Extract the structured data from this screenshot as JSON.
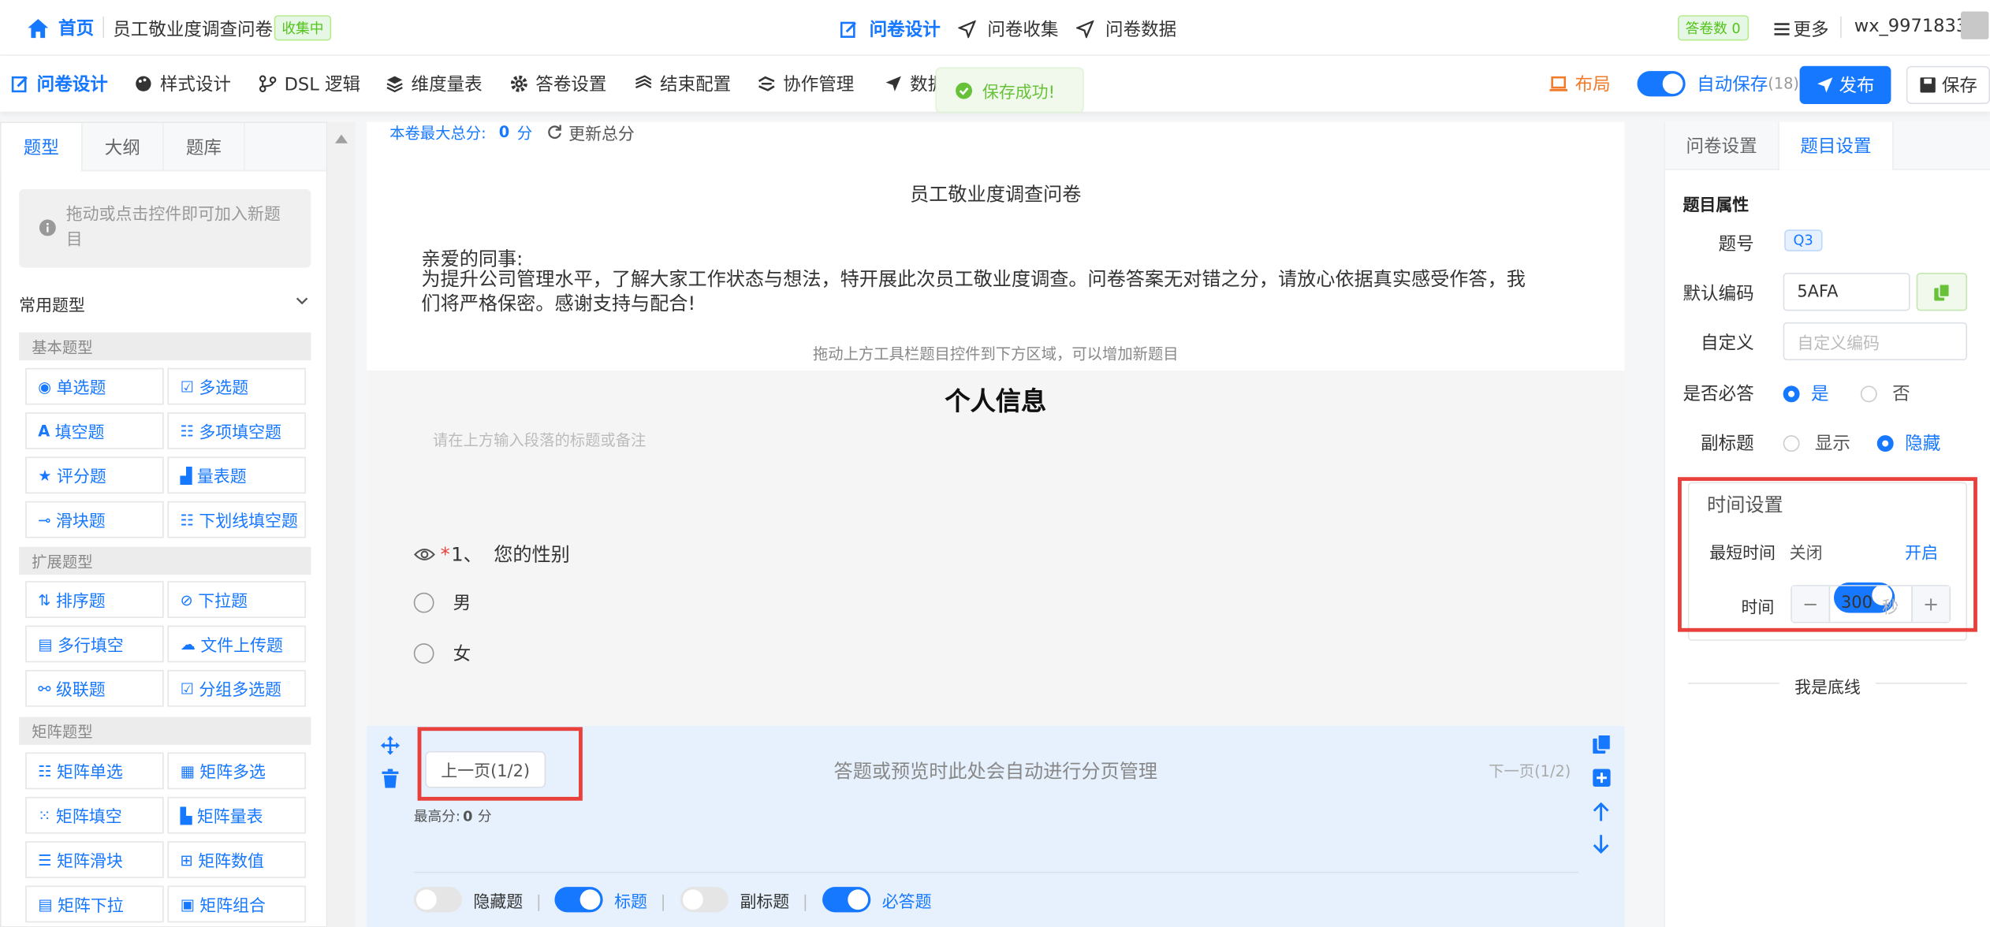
{
  "topbar": {
    "home": "首页",
    "survey_title": "员工敬业度调查问卷",
    "status_badge": "收集中",
    "nav": [
      "问卷设计",
      "问卷收集",
      "问卷数据"
    ],
    "answer_count": "答卷数 0",
    "more": "更多",
    "user": "wx_9971833"
  },
  "toolbar": {
    "items": [
      "问卷设计",
      "样式设计",
      "DSL 逻辑",
      "维度量表",
      "答卷设置",
      "结束配置",
      "协作管理",
      "数据"
    ],
    "layout": "布局",
    "autosave": "自动保存",
    "autosave_count": "(18)",
    "publish": "发布",
    "save": "保存"
  },
  "toast": "保存成功!",
  "left": {
    "tabs": [
      "题型",
      "大纲",
      "题库"
    ],
    "hint": "拖动或点击控件即可加入新题目",
    "section": "常用题型",
    "groups": [
      {
        "title": "基本题型",
        "items": [
          "单选题",
          "多选题",
          "填空题",
          "多项填空题",
          "评分题",
          "量表题",
          "滑块题",
          "下划线填空题"
        ]
      },
      {
        "title": "扩展题型",
        "items": [
          "排序题",
          "下拉题",
          "多行填空",
          "文件上传题",
          "级联题",
          "分组多选题"
        ]
      },
      {
        "title": "矩阵题型",
        "items": [
          "矩阵单选",
          "矩阵多选",
          "矩阵填空",
          "矩阵量表",
          "矩阵滑块",
          "矩阵数值",
          "矩阵下拉",
          "矩阵组合"
        ]
      }
    ]
  },
  "center": {
    "max_score_label": "本卷最大总分:",
    "max_score_value": "0",
    "score_unit": "分",
    "update_total": "更新总分",
    "title": "员工敬业度调查问卷",
    "intro_line1": "亲爱的同事:",
    "intro_line2": "为提升公司管理水平，了解大家工作状态与想法，特开展此次员工敬业度调查。问卷答案无对错之分，请放心依据真实感受作答，我们将严格保密。感谢支持与配合!",
    "drag_hint": "拖动上方工具栏题目控件到下方区域，可以增加新题目",
    "section_title": "个人信息",
    "section_placeholder": "请在上方输入段落的标题或备注",
    "q_required": "*",
    "q_num": "1、",
    "q_text": "您的性别",
    "options": [
      "男",
      "女"
    ],
    "pager_prev": "上一页(1/2)",
    "pager_hint": "答题或预览时此处会自动进行分页管理",
    "pager_next": "下一页(1/2)",
    "max_label": "最高分:",
    "max_value": "0",
    "toggles": [
      {
        "label": "隐藏题",
        "on": false
      },
      {
        "label": "标题",
        "on": true
      },
      {
        "label": "副标题",
        "on": false
      },
      {
        "label": "必答题",
        "on": true
      }
    ]
  },
  "right": {
    "tabs": [
      "问卷设置",
      "题目设置"
    ],
    "section": "题目属性",
    "qno_label": "题号",
    "qno_value": "Q3",
    "code_label": "默认编码",
    "code_value": "5AFA",
    "custom_label": "自定义",
    "custom_placeholder": "自定义编码",
    "required_label": "是否必答",
    "required_yes": "是",
    "required_no": "否",
    "subtitle_label": "副标题",
    "subtitle_show": "显示",
    "subtitle_hide": "隐藏",
    "time_title": "时间设置",
    "min_time_label": "最短时间",
    "off_label": "关闭",
    "on_label": "开启",
    "time_label": "时间",
    "time_value": "300",
    "time_unit": "秒",
    "footer": "我是底线"
  },
  "colors": {
    "accent": "#1677ff",
    "highlight": "#e8413b",
    "success": "#67c23a"
  }
}
